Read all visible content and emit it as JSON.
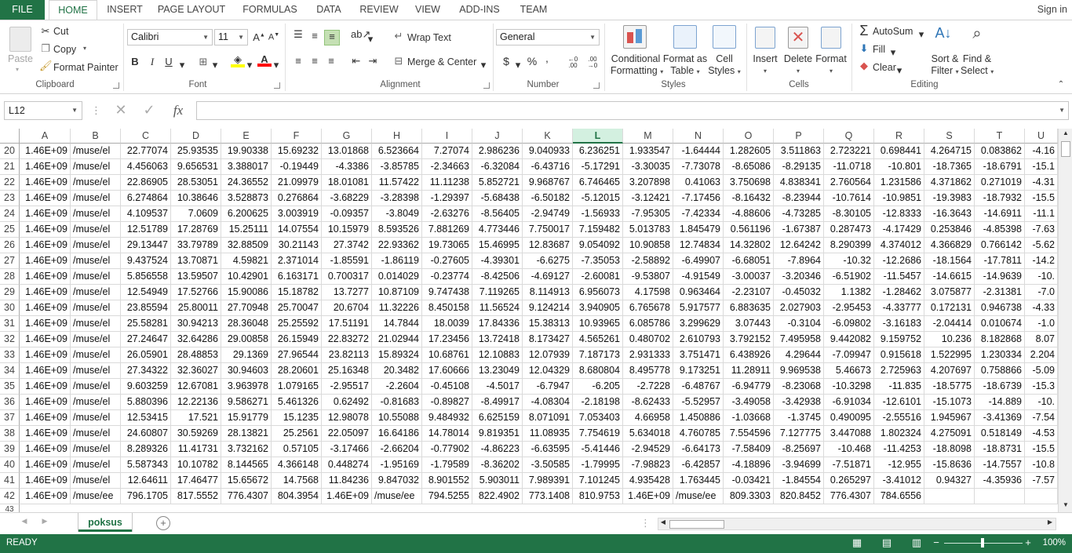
{
  "ribbon_tabs": [
    "FILE",
    "HOME",
    "INSERT",
    "PAGE LAYOUT",
    "FORMULAS",
    "DATA",
    "REVIEW",
    "VIEW",
    "ADD-INS",
    "TEAM"
  ],
  "signin": "Sign in",
  "clipboard": {
    "paste": "Paste",
    "cut": "Cut",
    "copy": "Copy",
    "format_painter": "Format Painter",
    "label": "Clipboard"
  },
  "font": {
    "name": "Calibri",
    "size": "11",
    "label": "Font",
    "bold": "B",
    "italic": "I",
    "underline": "U"
  },
  "alignment": {
    "wrap_text": "Wrap Text",
    "merge_center": "Merge & Center",
    "label": "Alignment"
  },
  "number": {
    "format": "General",
    "label": "Number",
    "currency": "$",
    "percent": "%",
    "comma": ",",
    "inc_dec": ".00",
    "dec_dec": ".00"
  },
  "styles": {
    "conditional": [
      "Conditional",
      "Formatting"
    ],
    "format_table": [
      "Format as",
      "Table"
    ],
    "cell_styles": [
      "Cell",
      "Styles"
    ],
    "label": "Styles"
  },
  "cells": {
    "insert": "Insert",
    "delete": "Delete",
    "format": "Format",
    "label": "Cells"
  },
  "editing": {
    "autosum": "AutoSum",
    "fill": "Fill",
    "clear": "Clear",
    "sort_filter": [
      "Sort &",
      "Filter"
    ],
    "find_select": [
      "Find &",
      "Select"
    ],
    "label": "Editing"
  },
  "namebox": "L12",
  "fx": "fx",
  "columns": [
    "A",
    "B",
    "C",
    "D",
    "E",
    "F",
    "G",
    "H",
    "I",
    "J",
    "K",
    "L",
    "M",
    "N",
    "O",
    "P",
    "Q",
    "R",
    "S",
    "T",
    "U"
  ],
  "selected_column": "L",
  "rows": [
    {
      "n": "20",
      "c": [
        "1.46E+09",
        "/muse/el",
        "22.77074",
        "25.93535",
        "19.90338",
        "15.69232",
        "13.01868",
        "6.523664",
        "7.27074",
        "2.986236",
        "9.040933",
        "6.236251",
        "1.933547",
        "-1.64444",
        "1.282605",
        "3.511863",
        "2.723221",
        "0.698441",
        "4.264715",
        "0.083862",
        "-4.16"
      ]
    },
    {
      "n": "21",
      "c": [
        "1.46E+09",
        "/muse/el",
        "4.456063",
        "9.656531",
        "3.388017",
        "-0.19449",
        "-4.3386",
        "-3.85785",
        "-2.34663",
        "-6.32084",
        "-6.43716",
        "-5.17291",
        "-3.30035",
        "-7.73078",
        "-8.65086",
        "-8.29135",
        "-11.0718",
        "-10.801",
        "-18.7365",
        "-18.6791",
        "-15.1"
      ]
    },
    {
      "n": "22",
      "c": [
        "1.46E+09",
        "/muse/el",
        "22.86905",
        "28.53051",
        "24.36552",
        "21.09979",
        "18.01081",
        "11.57422",
        "11.11238",
        "5.852721",
        "9.968767",
        "6.746465",
        "3.207898",
        "0.41063",
        "3.750698",
        "4.838341",
        "2.760564",
        "1.231586",
        "4.371862",
        "0.271019",
        "-4.31"
      ]
    },
    {
      "n": "23",
      "c": [
        "1.46E+09",
        "/muse/el",
        "6.274864",
        "10.38646",
        "3.528873",
        "0.276864",
        "-3.68229",
        "-3.28398",
        "-1.29397",
        "-5.68438",
        "-6.50182",
        "-5.12015",
        "-3.12421",
        "-7.17456",
        "-8.16432",
        "-8.23944",
        "-10.7614",
        "-10.9851",
        "-19.3983",
        "-18.7932",
        "-15.5"
      ]
    },
    {
      "n": "24",
      "c": [
        "1.46E+09",
        "/muse/el",
        "4.109537",
        "7.0609",
        "6.200625",
        "3.003919",
        "-0.09357",
        "-3.8049",
        "-2.63276",
        "-8.56405",
        "-2.94749",
        "-1.56933",
        "-7.95305",
        "-7.42334",
        "-4.88606",
        "-4.73285",
        "-8.30105",
        "-12.8333",
        "-16.3643",
        "-14.6911",
        "-11.1"
      ]
    },
    {
      "n": "25",
      "c": [
        "1.46E+09",
        "/muse/el",
        "12.51789",
        "17.28769",
        "15.25111",
        "14.07554",
        "10.15979",
        "8.593526",
        "7.881269",
        "4.773446",
        "7.750017",
        "7.159482",
        "5.013783",
        "1.845479",
        "0.561196",
        "-1.67387",
        "0.287473",
        "-4.17429",
        "0.253846",
        "-4.85398",
        "-7.63"
      ]
    },
    {
      "n": "26",
      "c": [
        "1.46E+09",
        "/muse/el",
        "29.13447",
        "33.79789",
        "32.88509",
        "30.21143",
        "27.3742",
        "22.93362",
        "19.73065",
        "15.46995",
        "12.83687",
        "9.054092",
        "10.90858",
        "12.74834",
        "14.32802",
        "12.64242",
        "8.290399",
        "4.374012",
        "4.366829",
        "0.766142",
        "-5.62"
      ]
    },
    {
      "n": "27",
      "c": [
        "1.46E+09",
        "/muse/el",
        "9.437524",
        "13.70871",
        "4.59821",
        "2.371014",
        "-1.85591",
        "-1.86119",
        "-0.27605",
        "-4.39301",
        "-6.6275",
        "-7.35053",
        "-2.58892",
        "-6.49907",
        "-6.68051",
        "-7.8964",
        "-10.32",
        "-12.2686",
        "-18.1564",
        "-17.7811",
        "-14.2"
      ]
    },
    {
      "n": "28",
      "c": [
        "1.46E+09",
        "/muse/el",
        "5.856558",
        "13.59507",
        "10.42901",
        "6.163171",
        "0.700317",
        "0.014029",
        "-0.23774",
        "-8.42506",
        "-4.69127",
        "-2.60081",
        "-9.53807",
        "-4.91549",
        "-3.00037",
        "-3.20346",
        "-6.51902",
        "-11.5457",
        "-14.6615",
        "-14.9639",
        "-10."
      ]
    },
    {
      "n": "29",
      "c": [
        "1.46E+09",
        "/muse/el",
        "12.54949",
        "17.52766",
        "15.90086",
        "15.18782",
        "13.7277",
        "10.87109",
        "9.747438",
        "7.119265",
        "8.114913",
        "6.956073",
        "4.17598",
        "0.963464",
        "-2.23107",
        "-0.45032",
        "1.1382",
        "-1.28462",
        "3.075877",
        "-2.31381",
        "-7.0"
      ]
    },
    {
      "n": "30",
      "c": [
        "1.46E+09",
        "/muse/el",
        "23.85594",
        "25.80011",
        "27.70948",
        "25.70047",
        "20.6704",
        "11.32226",
        "8.450158",
        "11.56524",
        "9.124214",
        "3.940905",
        "6.765678",
        "5.917577",
        "6.883635",
        "2.027903",
        "-2.95453",
        "-4.33777",
        "0.172131",
        "0.946738",
        "-4.33"
      ]
    },
    {
      "n": "31",
      "c": [
        "1.46E+09",
        "/muse/el",
        "25.58281",
        "30.94213",
        "28.36048",
        "25.25592",
        "17.51191",
        "14.7844",
        "18.0039",
        "17.84336",
        "15.38313",
        "10.93965",
        "6.085786",
        "3.299629",
        "3.07443",
        "-0.3104",
        "-6.09802",
        "-3.16183",
        "-2.04414",
        "0.010674",
        "-1.0"
      ]
    },
    {
      "n": "32",
      "c": [
        "1.46E+09",
        "/muse/el",
        "27.24647",
        "32.64286",
        "29.00858",
        "26.15949",
        "22.83272",
        "21.02944",
        "17.23456",
        "13.72418",
        "8.173427",
        "4.565261",
        "0.480702",
        "2.610793",
        "3.792152",
        "7.495958",
        "9.442082",
        "9.159752",
        "10.236",
        "8.182868",
        "8.07"
      ]
    },
    {
      "n": "33",
      "c": [
        "1.46E+09",
        "/muse/el",
        "26.05901",
        "28.48853",
        "29.1369",
        "27.96544",
        "23.82113",
        "15.89324",
        "10.68761",
        "12.10883",
        "12.07939",
        "7.187173",
        "2.931333",
        "3.751471",
        "6.438926",
        "4.29644",
        "-7.09947",
        "0.915618",
        "1.522995",
        "1.230334",
        "2.204"
      ]
    },
    {
      "n": "34",
      "c": [
        "1.46E+09",
        "/muse/el",
        "27.34322",
        "32.36027",
        "30.94603",
        "28.20601",
        "25.16348",
        "20.3482",
        "17.60666",
        "13.23049",
        "12.04329",
        "8.680804",
        "8.495778",
        "9.173251",
        "11.28911",
        "9.969538",
        "5.46673",
        "2.725963",
        "4.207697",
        "0.758866",
        "-5.09"
      ]
    },
    {
      "n": "35",
      "c": [
        "1.46E+09",
        "/muse/el",
        "9.603259",
        "12.67081",
        "3.963978",
        "1.079165",
        "-2.95517",
        "-2.2604",
        "-0.45108",
        "-4.5017",
        "-6.7947",
        "-6.205",
        "-2.7228",
        "-6.48767",
        "-6.94779",
        "-8.23068",
        "-10.3298",
        "-11.835",
        "-18.5775",
        "-18.6739",
        "-15.3"
      ]
    },
    {
      "n": "36",
      "c": [
        "1.46E+09",
        "/muse/el",
        "5.880396",
        "12.22136",
        "9.586271",
        "5.461326",
        "0.62492",
        "-0.81683",
        "-0.89827",
        "-8.49917",
        "-4.08304",
        "-2.18198",
        "-8.62433",
        "-5.52957",
        "-3.49058",
        "-3.42938",
        "-6.91034",
        "-12.6101",
        "-15.1073",
        "-14.889",
        "-10."
      ]
    },
    {
      "n": "37",
      "c": [
        "1.46E+09",
        "/muse/el",
        "12.53415",
        "17.521",
        "15.91779",
        "15.1235",
        "12.98078",
        "10.55088",
        "9.484932",
        "6.625159",
        "8.071091",
        "7.053403",
        "4.66958",
        "1.450886",
        "-1.03668",
        "-1.3745",
        "0.490095",
        "-2.55516",
        "1.945967",
        "-3.41369",
        "-7.54"
      ]
    },
    {
      "n": "38",
      "c": [
        "1.46E+09",
        "/muse/el",
        "24.60807",
        "30.59269",
        "28.13821",
        "25.2561",
        "22.05097",
        "16.64186",
        "14.78014",
        "9.819351",
        "11.08935",
        "7.754619",
        "5.634018",
        "4.760785",
        "7.554596",
        "7.127775",
        "3.447088",
        "1.802324",
        "4.275091",
        "0.518149",
        "-4.53"
      ]
    },
    {
      "n": "39",
      "c": [
        "1.46E+09",
        "/muse/el",
        "8.289326",
        "11.41731",
        "3.732162",
        "0.57105",
        "-3.17466",
        "-2.66204",
        "-0.77902",
        "-4.86223",
        "-6.63595",
        "-5.41446",
        "-2.94529",
        "-6.64173",
        "-7.58409",
        "-8.25697",
        "-10.468",
        "-11.4253",
        "-18.8098",
        "-18.8731",
        "-15.5"
      ]
    },
    {
      "n": "40",
      "c": [
        "1.46E+09",
        "/muse/el",
        "5.587343",
        "10.10782",
        "8.144565",
        "4.366148",
        "0.448274",
        "-1.95169",
        "-1.79589",
        "-8.36202",
        "-3.50585",
        "-1.79995",
        "-7.98823",
        "-6.42857",
        "-4.18896",
        "-3.94699",
        "-7.51871",
        "-12.955",
        "-15.8636",
        "-14.7557",
        "-10.8"
      ]
    },
    {
      "n": "41",
      "c": [
        "1.46E+09",
        "/muse/el",
        "12.64611",
        "17.46477",
        "15.65672",
        "14.7568",
        "11.84236",
        "9.847032",
        "8.901552",
        "5.903011",
        "7.989391",
        "7.101245",
        "4.935428",
        "1.763445",
        "-0.03421",
        "-1.84554",
        "0.265297",
        "-3.41012",
        "0.94327",
        "-4.35936",
        "-7.57"
      ]
    },
    {
      "n": "42",
      "c": [
        "1.46E+09",
        "/muse/ee",
        "796.1705",
        "817.5552",
        "776.4307",
        "804.3954",
        "1.46E+09",
        "/muse/ee",
        "794.5255",
        "822.4902",
        "773.1408",
        "810.9753",
        "1.46E+09",
        "/muse/ee",
        "809.3303",
        "820.8452",
        "776.4307",
        "784.6556",
        "",
        "",
        ""
      ]
    }
  ],
  "partial_row": "43",
  "sheet_tab": "poksus",
  "status": "READY",
  "zoom": "100%"
}
